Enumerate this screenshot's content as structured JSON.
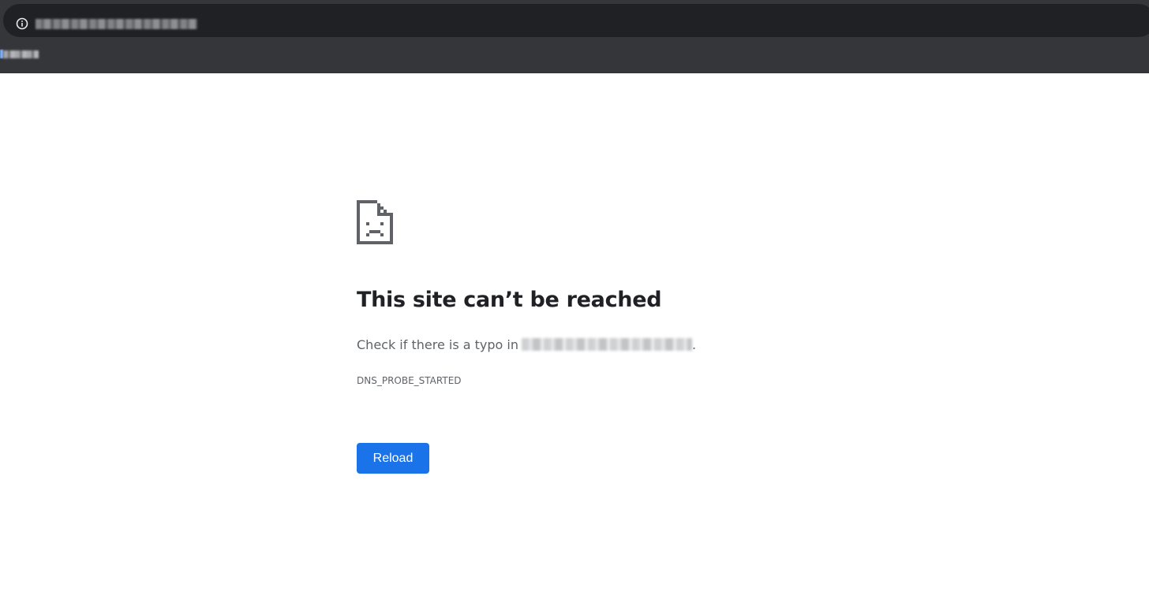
{
  "browser": {
    "toolbar_bg": "#35363a",
    "omnibox_bg": "#202124",
    "site_info_icon": "info-circle-icon",
    "bookmark_fav_color": "#7ab1ff"
  },
  "error_page": {
    "icon": "sad-document-icon",
    "title": "This site can’t be reached",
    "message_prefix": "Check if there is a typo in",
    "message_suffix": ".",
    "error_code": "DNS_PROBE_STARTED",
    "reload_label": "Reload",
    "accent_color": "#1a73e8"
  }
}
